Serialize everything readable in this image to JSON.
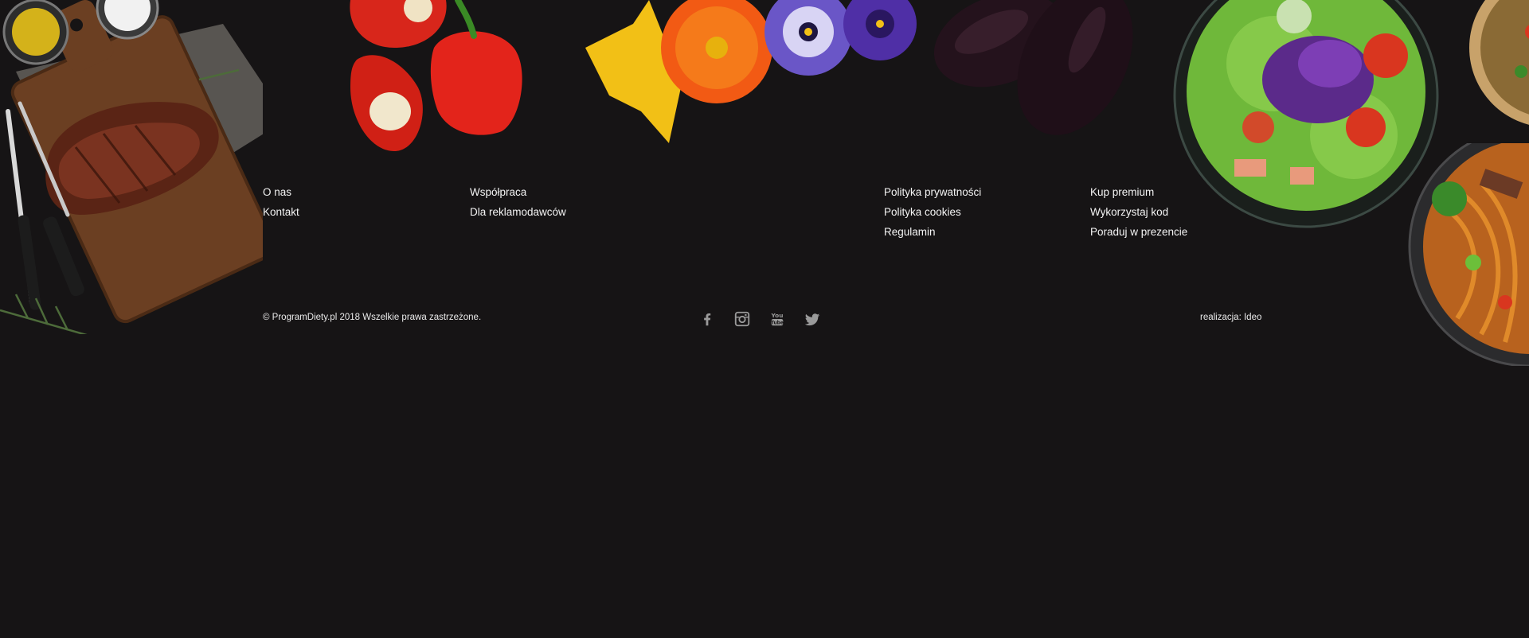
{
  "footer": {
    "columns": [
      {
        "links": [
          "O nas",
          "Kontakt"
        ]
      },
      {
        "links": [
          "Współpraca",
          "Dla reklamodawców"
        ]
      },
      {
        "links": [
          "Polityka prywatności",
          "Polityka cookies",
          "Regulamin"
        ]
      },
      {
        "links": [
          "Kup premium",
          "Wykorzystaj kod",
          "Poraduj w prezencie"
        ]
      }
    ],
    "copyright": "© ProgramDiety.pl 2018 Wszelkie prawa zastrzeżone.",
    "credit_prefix": "realizacja:",
    "credit_link": "Ideo",
    "social": [
      "facebook-icon",
      "instagram-icon",
      "youtube-icon",
      "twitter-icon"
    ]
  },
  "colors": {
    "background": "#161415",
    "text": "#f2f2f2",
    "icon": "#9a9a9a"
  }
}
